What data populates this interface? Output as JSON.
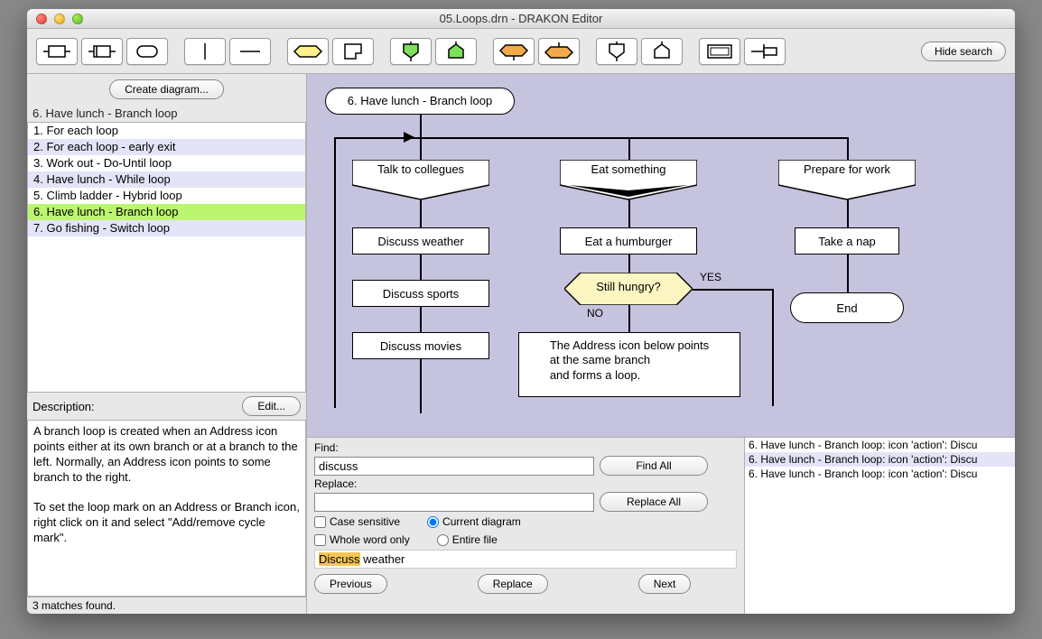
{
  "window": {
    "title": "05.Loops.drn - DRAKON Editor"
  },
  "toolbar": {
    "hide_search": "Hide search"
  },
  "sidebar": {
    "create_btn": "Create diagram...",
    "current": "6. Have lunch - Branch loop",
    "items": [
      {
        "label": "1. For each loop",
        "alt": false
      },
      {
        "label": "2. For each loop - early exit",
        "alt": true
      },
      {
        "label": "3. Work out - Do-Until loop",
        "alt": false
      },
      {
        "label": "4. Have lunch - While loop",
        "alt": true
      },
      {
        "label": "5. Climb ladder - Hybrid loop",
        "alt": false
      },
      {
        "label": "6. Have lunch - Branch loop",
        "alt": true,
        "selected": true
      },
      {
        "label": "7. Go fishing - Switch loop",
        "alt": false
      }
    ],
    "description_label": "Description:",
    "edit_btn": "Edit...",
    "description": "A branch loop is created when an Address icon points either at its own branch or at a branch to the left. Normally, an Address icon points to some branch to the right.\n\nTo set the loop mark on an Address or Branch icon, right click on it and select \"Add/remove cycle mark\"."
  },
  "status": "3 matches found.",
  "diagram": {
    "title": "6. Have lunch - Branch loop",
    "branch1": "Talk to collegues",
    "branch2": "Eat something",
    "branch3": "Prepare for work",
    "action1": "Discuss weather",
    "action2": "Discuss sports",
    "action3": "Discuss movies",
    "action4": "Eat a humburger",
    "question": "Still hungry?",
    "yes": "YES",
    "no": "NO",
    "comment": "The Address icon below points\nat the same branch\nand forms a loop.",
    "action5": "Take a nap",
    "end": "End"
  },
  "search": {
    "find_label": "Find:",
    "find_value": "discuss",
    "replace_label": "Replace:",
    "replace_value": "",
    "find_all_btn": "Find All",
    "replace_all_btn": "Replace All",
    "case_sensitive": "Case sensitive",
    "whole_word": "Whole word only",
    "current_diagram": "Current diagram",
    "entire_file": "Entire file",
    "preview_hl": "Discuss",
    "preview_rest": " weather",
    "prev_btn": "Previous",
    "replace_btn": "Replace",
    "next_btn": "Next",
    "results": [
      "6. Have lunch - Branch loop: icon 'action': Discu",
      "6. Have lunch - Branch loop: icon 'action': Discu",
      "6. Have lunch - Branch loop: icon 'action': Discu"
    ]
  }
}
